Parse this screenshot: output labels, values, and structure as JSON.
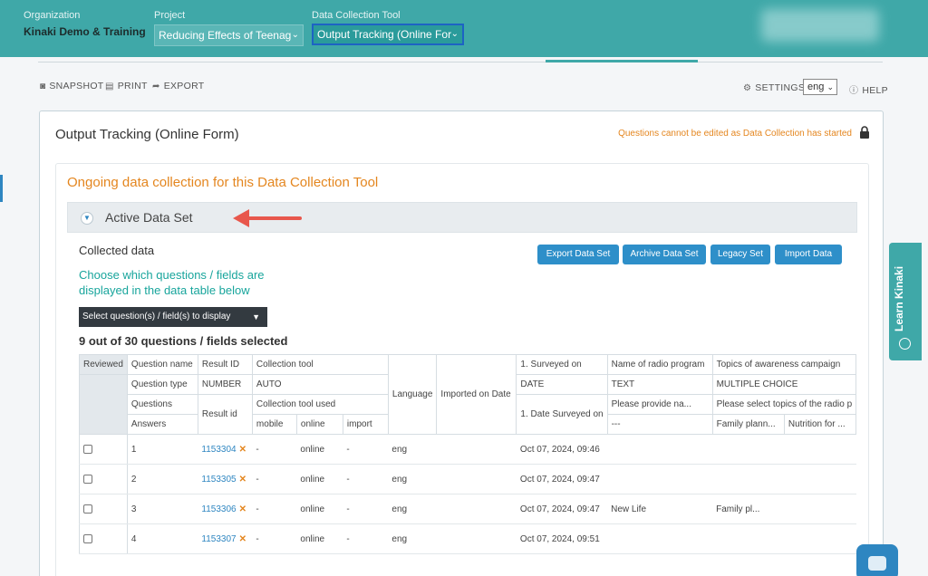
{
  "topbar": {
    "org_label": "Organization",
    "org_name": "Kinaki Demo & Training",
    "project_label": "Project",
    "project_value": "Reducing Effects of Teenag",
    "tool_label": "Data Collection Tool",
    "tool_value": "Output Tracking (Online For"
  },
  "toolbar": {
    "snapshot": "SNAPSHOT",
    "print": "PRINT",
    "export": "EXPORT",
    "settings": "SETTINGS",
    "lang": "eng",
    "help": "HELP"
  },
  "card": {
    "title": "Output Tracking (Online Form)",
    "warning": "Questions cannot be edited as Data Collection has started",
    "ongoing": "Ongoing data collection for this Data Collection Tool",
    "dataset_title": "Active Data Set",
    "collected": "Collected data",
    "choose": "Choose which questions / fields are displayed in the data table below",
    "buttons": {
      "export": "Export Data Set",
      "archive": "Archive Data Set",
      "legacy": "Legacy Set",
      "import": "Import Data"
    },
    "dropdown": "Select question(s) / field(s) to display",
    "selected_count": "9 out of 30 questions / fields selected"
  },
  "table": {
    "reviewed": "Reviewed",
    "row_question_name": "Question name",
    "row_question_type": "Question type",
    "row_questions": "Questions",
    "row_answers": "Answers",
    "result_id": "Result ID",
    "number": "NUMBER",
    "result_id_lower": "Result id",
    "collection_tool": "Collection tool",
    "auto": "AUTO",
    "collection_tool_used": "Collection tool used",
    "mobile": "mobile",
    "online": "online",
    "import": "import",
    "language": "Language",
    "imported_on": "Imported on Date",
    "surveyed_on": "1. Surveyed on",
    "date": "DATE",
    "date_surveyed_on": "1. Date Surveyed on",
    "radio_name": "Name of radio program",
    "text": "TEXT",
    "provide_name": "Please provide na...",
    "dashes": "---",
    "topics": "Topics of awareness campaign",
    "multiple_choice": "MULTIPLE CHOICE",
    "select_topics": "Please select topics of the radio p",
    "family_planning": "Family plann...",
    "nutrition": "Nutrition for ...",
    "rows": [
      {
        "num": "1",
        "id": "1153304",
        "mobile": "-",
        "online": "online",
        "import": "-",
        "lang": "eng",
        "surveyed": "Oct 07, 2024, 09:46",
        "radio": "",
        "topic": ""
      },
      {
        "num": "2",
        "id": "1153305",
        "mobile": "-",
        "online": "online",
        "import": "-",
        "lang": "eng",
        "surveyed": "Oct 07, 2024, 09:47",
        "radio": "",
        "topic": ""
      },
      {
        "num": "3",
        "id": "1153306",
        "mobile": "-",
        "online": "online",
        "import": "-",
        "lang": "eng",
        "surveyed": "Oct 07, 2024, 09:47",
        "radio": "New Life",
        "topic": "Family pl..."
      },
      {
        "num": "4",
        "id": "1153307",
        "mobile": "-",
        "online": "online",
        "import": "-",
        "lang": "eng",
        "surveyed": "Oct 07, 2024, 09:51",
        "radio": "",
        "topic": ""
      }
    ]
  },
  "learn": "Learn Kinaki",
  "colors": {
    "teal": "#3fa8a8",
    "orange": "#e4861f",
    "blue": "#2e8fc9",
    "red_arrow": "#e8574c"
  }
}
